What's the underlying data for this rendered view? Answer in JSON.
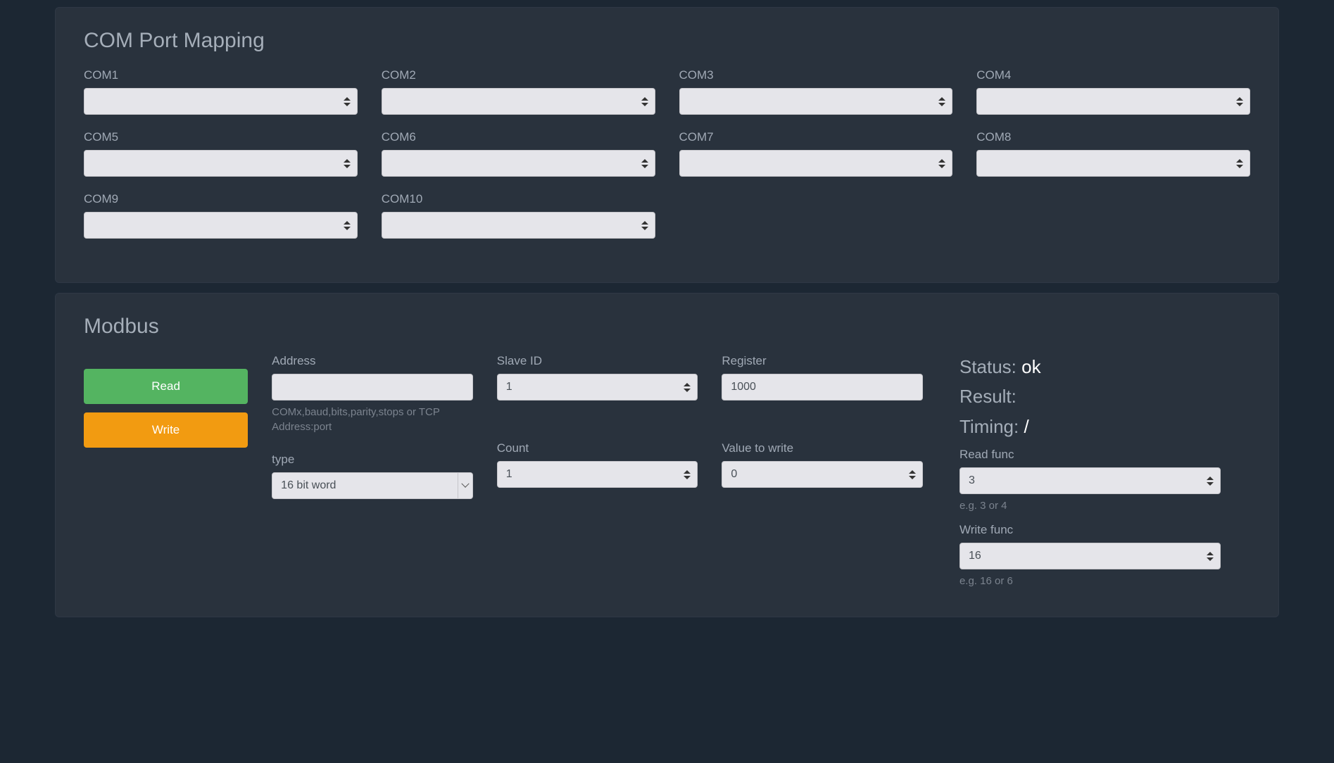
{
  "com_panel": {
    "title": "COM Port Mapping",
    "ports": [
      {
        "label": "COM1",
        "value": ""
      },
      {
        "label": "COM2",
        "value": ""
      },
      {
        "label": "COM3",
        "value": ""
      },
      {
        "label": "COM4",
        "value": ""
      },
      {
        "label": "COM5",
        "value": ""
      },
      {
        "label": "COM6",
        "value": ""
      },
      {
        "label": "COM7",
        "value": ""
      },
      {
        "label": "COM8",
        "value": ""
      },
      {
        "label": "COM9",
        "value": ""
      },
      {
        "label": "COM10",
        "value": ""
      }
    ]
  },
  "modbus": {
    "title": "Modbus",
    "buttons": {
      "read": "Read",
      "write": "Write"
    },
    "address": {
      "label": "Address",
      "value": "",
      "help": "COMx,baud,bits,parity,stops or TCP Address:port"
    },
    "slave_id": {
      "label": "Slave ID",
      "value": "1"
    },
    "register": {
      "label": "Register",
      "value": "1000"
    },
    "type": {
      "label": "type",
      "value": "16 bit word"
    },
    "count": {
      "label": "Count",
      "value": "1"
    },
    "value_to_write": {
      "label": "Value to write",
      "value": "0"
    },
    "status": {
      "status_label": "Status:",
      "status_value": "ok",
      "result_label": "Result:",
      "result_value": "",
      "timing_label": "Timing:",
      "timing_value": "/"
    },
    "read_func": {
      "label": "Read func",
      "value": "3",
      "help": "e.g. 3 or 4"
    },
    "write_func": {
      "label": "Write func",
      "value": "16",
      "help": "e.g. 16 or 6"
    }
  }
}
